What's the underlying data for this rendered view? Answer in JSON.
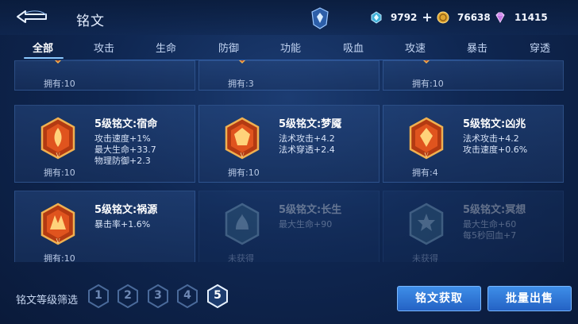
{
  "header": {
    "title": "铭文",
    "currencies": [
      {
        "icon": "crystal-icon",
        "value": "9792",
        "has_plus": true
      },
      {
        "icon": "gold-coin-icon",
        "value": "76638"
      },
      {
        "icon": "diamond-icon",
        "value": "11415"
      }
    ]
  },
  "tabs": [
    "全部",
    "攻击",
    "生命",
    "防御",
    "功能",
    "吸血",
    "攻速",
    "暴击",
    "穿透"
  ],
  "active_tab": "全部",
  "top_row": [
    {
      "owned": "拥有:10"
    },
    {
      "owned": "拥有:3"
    },
    {
      "owned": "拥有:10"
    }
  ],
  "cards": [
    {
      "name": "5级铭文:宿命",
      "attrs": [
        "攻击速度+1%",
        "最大生命+33.7",
        "物理防御+2.3"
      ],
      "owned": "拥有:10",
      "color": "#e0541e",
      "obtained": true
    },
    {
      "name": "5级铭文:梦魇",
      "attrs": [
        "法术攻击+4.2",
        "法术穿透+2.4"
      ],
      "owned": "拥有:10",
      "color": "#e0541e",
      "obtained": true
    },
    {
      "name": "5级铭文:凶兆",
      "attrs": [
        "法术攻击+4.2",
        "攻击速度+0.6%"
      ],
      "owned": "拥有:4",
      "color": "#e0541e",
      "obtained": true
    },
    {
      "name": "5级铭文:祸源",
      "attrs": [
        "暴击率+1.6%"
      ],
      "owned": "拥有:10",
      "color": "#e0541e",
      "obtained": true
    },
    {
      "name": "5级铭文:长生",
      "attrs": [
        "最大生命+90"
      ],
      "owned": "未获得",
      "color": "#6fa6c8",
      "obtained": false
    },
    {
      "name": "5级铭文:冥想",
      "attrs": [
        "最大生命+60",
        "每5秒回血+7"
      ],
      "owned": "未获得",
      "color": "#6fa6c8",
      "obtained": false
    }
  ],
  "footer": {
    "filter_label": "铭文等级筛选",
    "levels": [
      "1",
      "2",
      "3",
      "4",
      "5"
    ],
    "active_level": "5",
    "acquire_button": "铭文获取",
    "bulk_sell_button": "批量出售"
  }
}
